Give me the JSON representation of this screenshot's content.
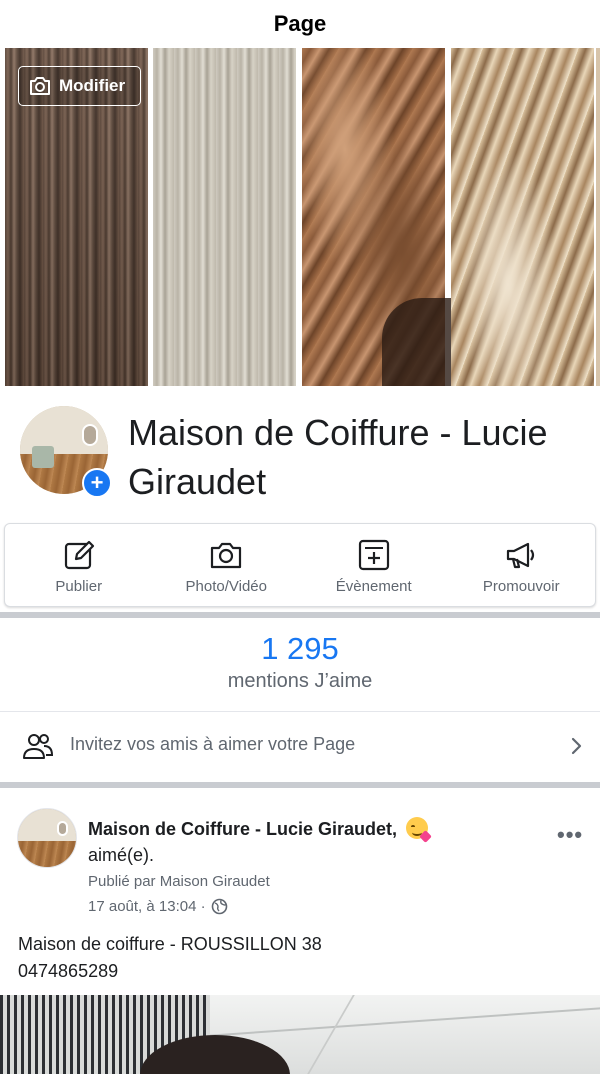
{
  "nav": {
    "title": "Page"
  },
  "cover": {
    "edit_label": "Modifier",
    "pager": {
      "count": 2,
      "active": 1
    }
  },
  "profile": {
    "name": "Maison de Coiffure - Lucie Giraudet",
    "add_badge": "+"
  },
  "actions": [
    {
      "label": "Publier",
      "icon": "pencil-square-icon"
    },
    {
      "label": "Photo/Vidéo",
      "icon": "camera-icon"
    },
    {
      "label": "Évènement",
      "icon": "calendar-plus-icon"
    },
    {
      "label": "Promouvoir",
      "icon": "megaphone-icon"
    }
  ],
  "likes": {
    "count": "1 295",
    "label": "mentions J’aime"
  },
  "invite": {
    "text": "Invitez vos amis à aimer votre Page",
    "icon": "people-icon"
  },
  "post": {
    "author": "Maison de Coiffure - Lucie Giraudet,",
    "feeling": "aimé(e).",
    "published_by": "Publié par Maison Giraudet",
    "date": "17 août, à 13:04 ·",
    "body": "Maison de coiffure - ROUSSILLON 38\n0474865289"
  },
  "colors": {
    "accent": "#1877f2",
    "muted_text": "#606770",
    "separator": "#c9ccd1"
  }
}
